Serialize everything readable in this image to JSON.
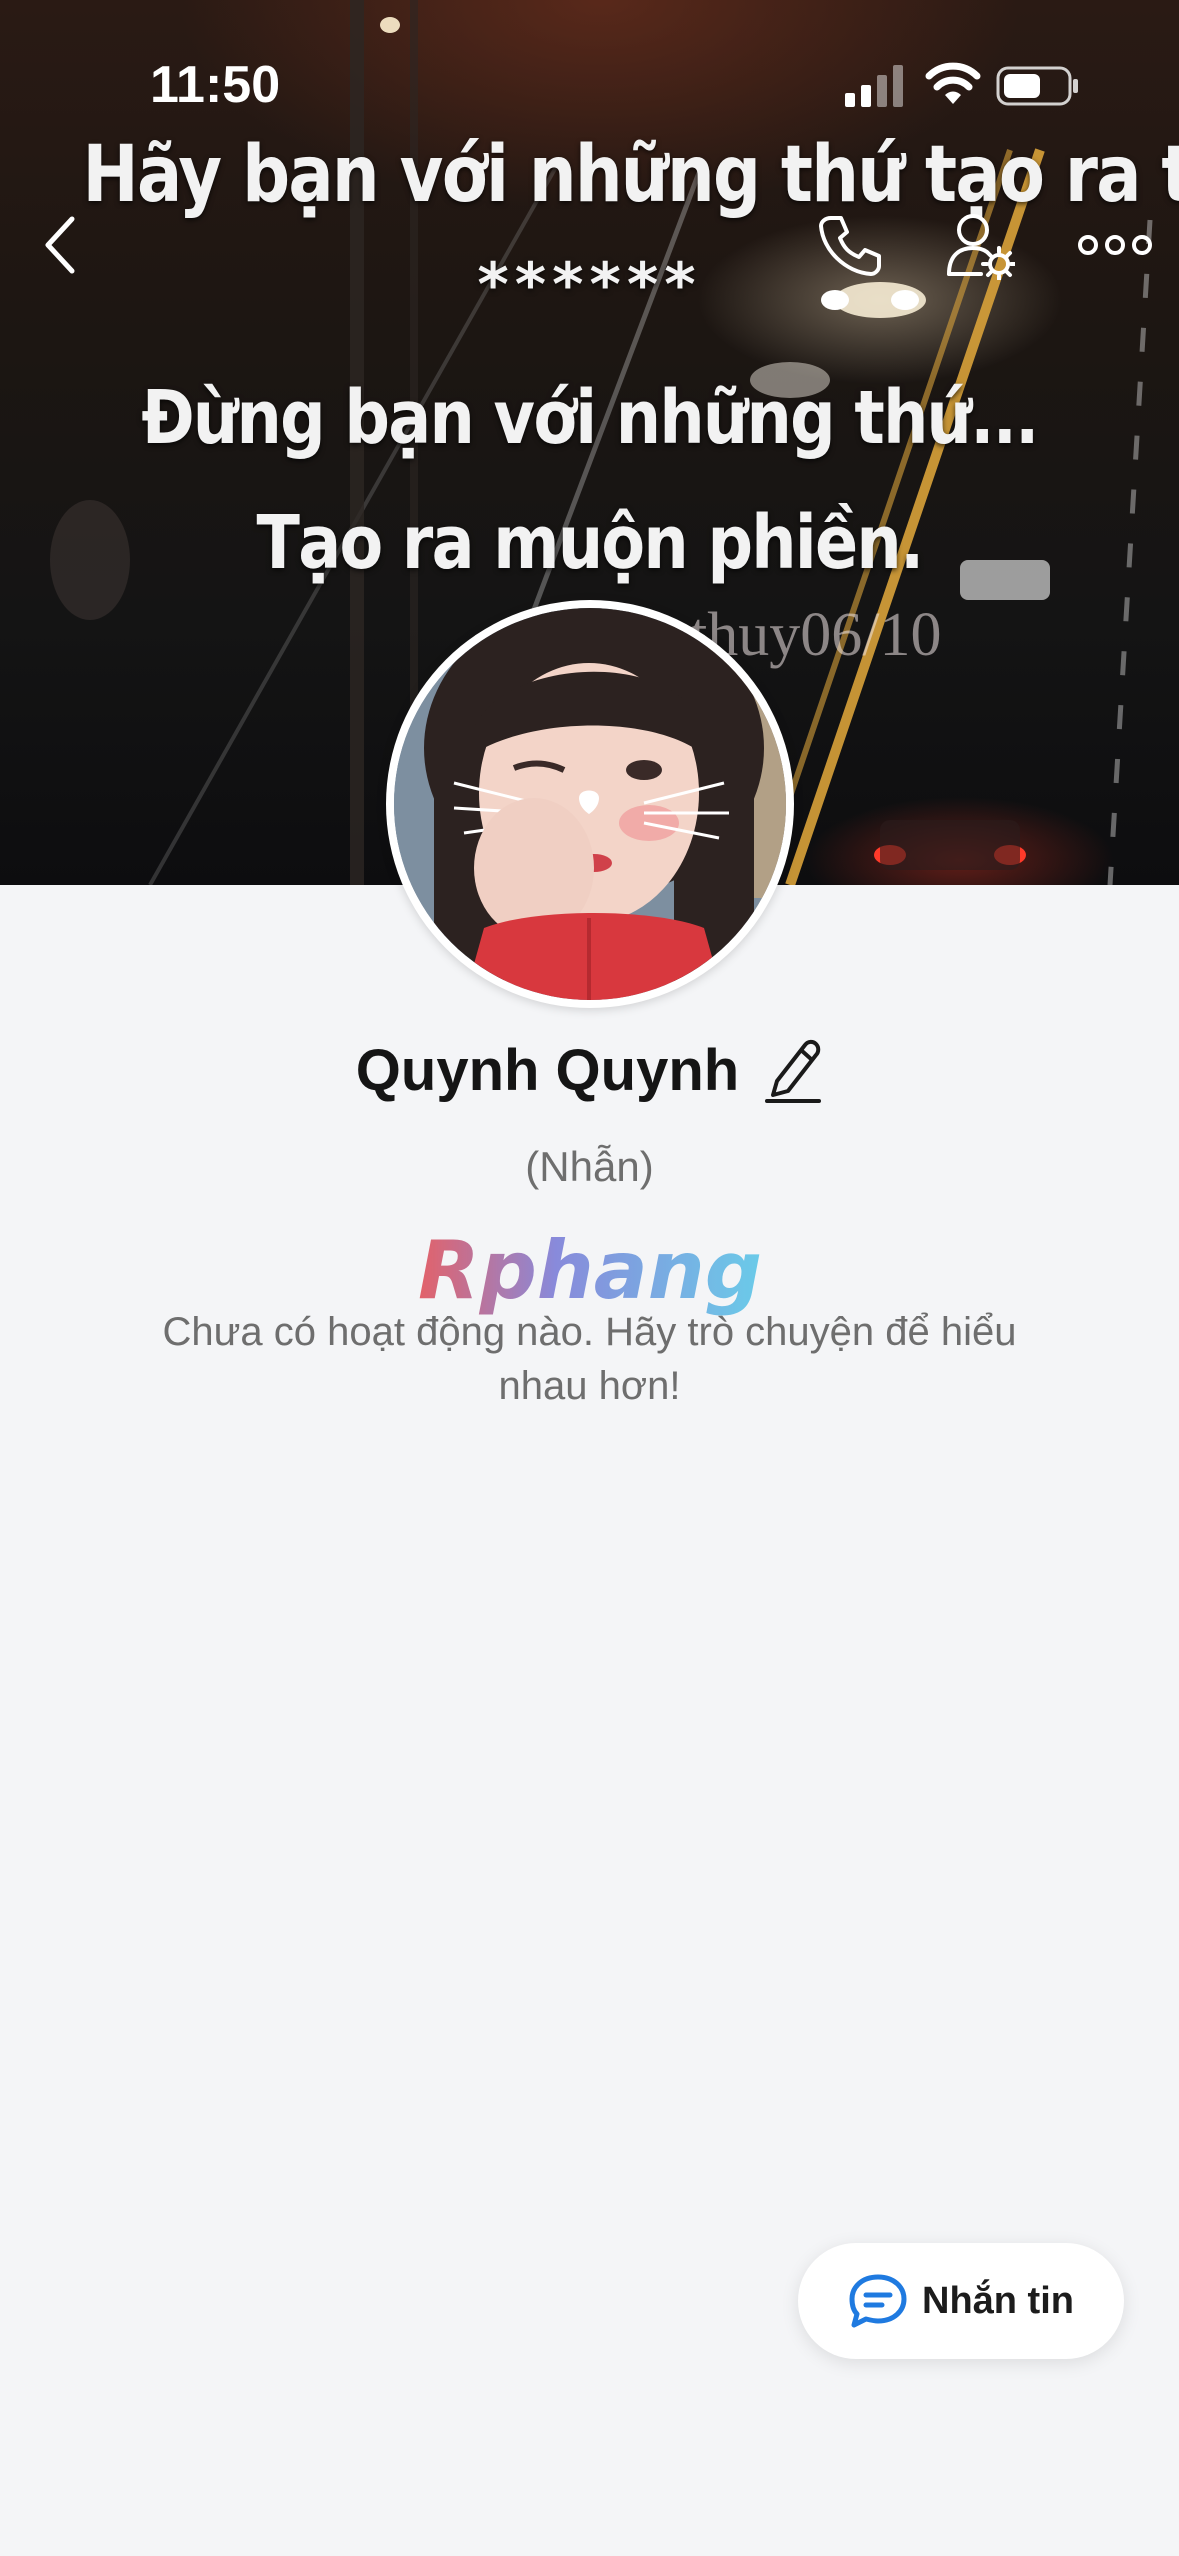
{
  "status_bar": {
    "time": "11:50"
  },
  "cover": {
    "line1": "Hãy bạn với những thứ tạo ra tiền...",
    "line2": "******",
    "line3": "Đừng bạn với những thứ...",
    "line4": "Tạo ra muộn phiền.",
    "signature": "thuy06/10"
  },
  "nav": {
    "back_icon": "chevron-left-icon",
    "call_icon": "phone-icon",
    "settings_icon": "user-settings-icon",
    "more_icon": "more-dots-icon"
  },
  "profile": {
    "name": "Quynh Quynh",
    "nickname": "(Nhẫn)",
    "watermark": "Rphang",
    "empty_message": "Chưa có hoạt động nào. Hãy trò chuyện để hiểu nhau hơn!"
  },
  "actions": {
    "message_label": "Nhắn tin"
  },
  "colors": {
    "background": "#f4f5f7",
    "accent": "#1f7ae0",
    "text_primary": "#151515",
    "text_secondary": "#6e6e6e"
  }
}
